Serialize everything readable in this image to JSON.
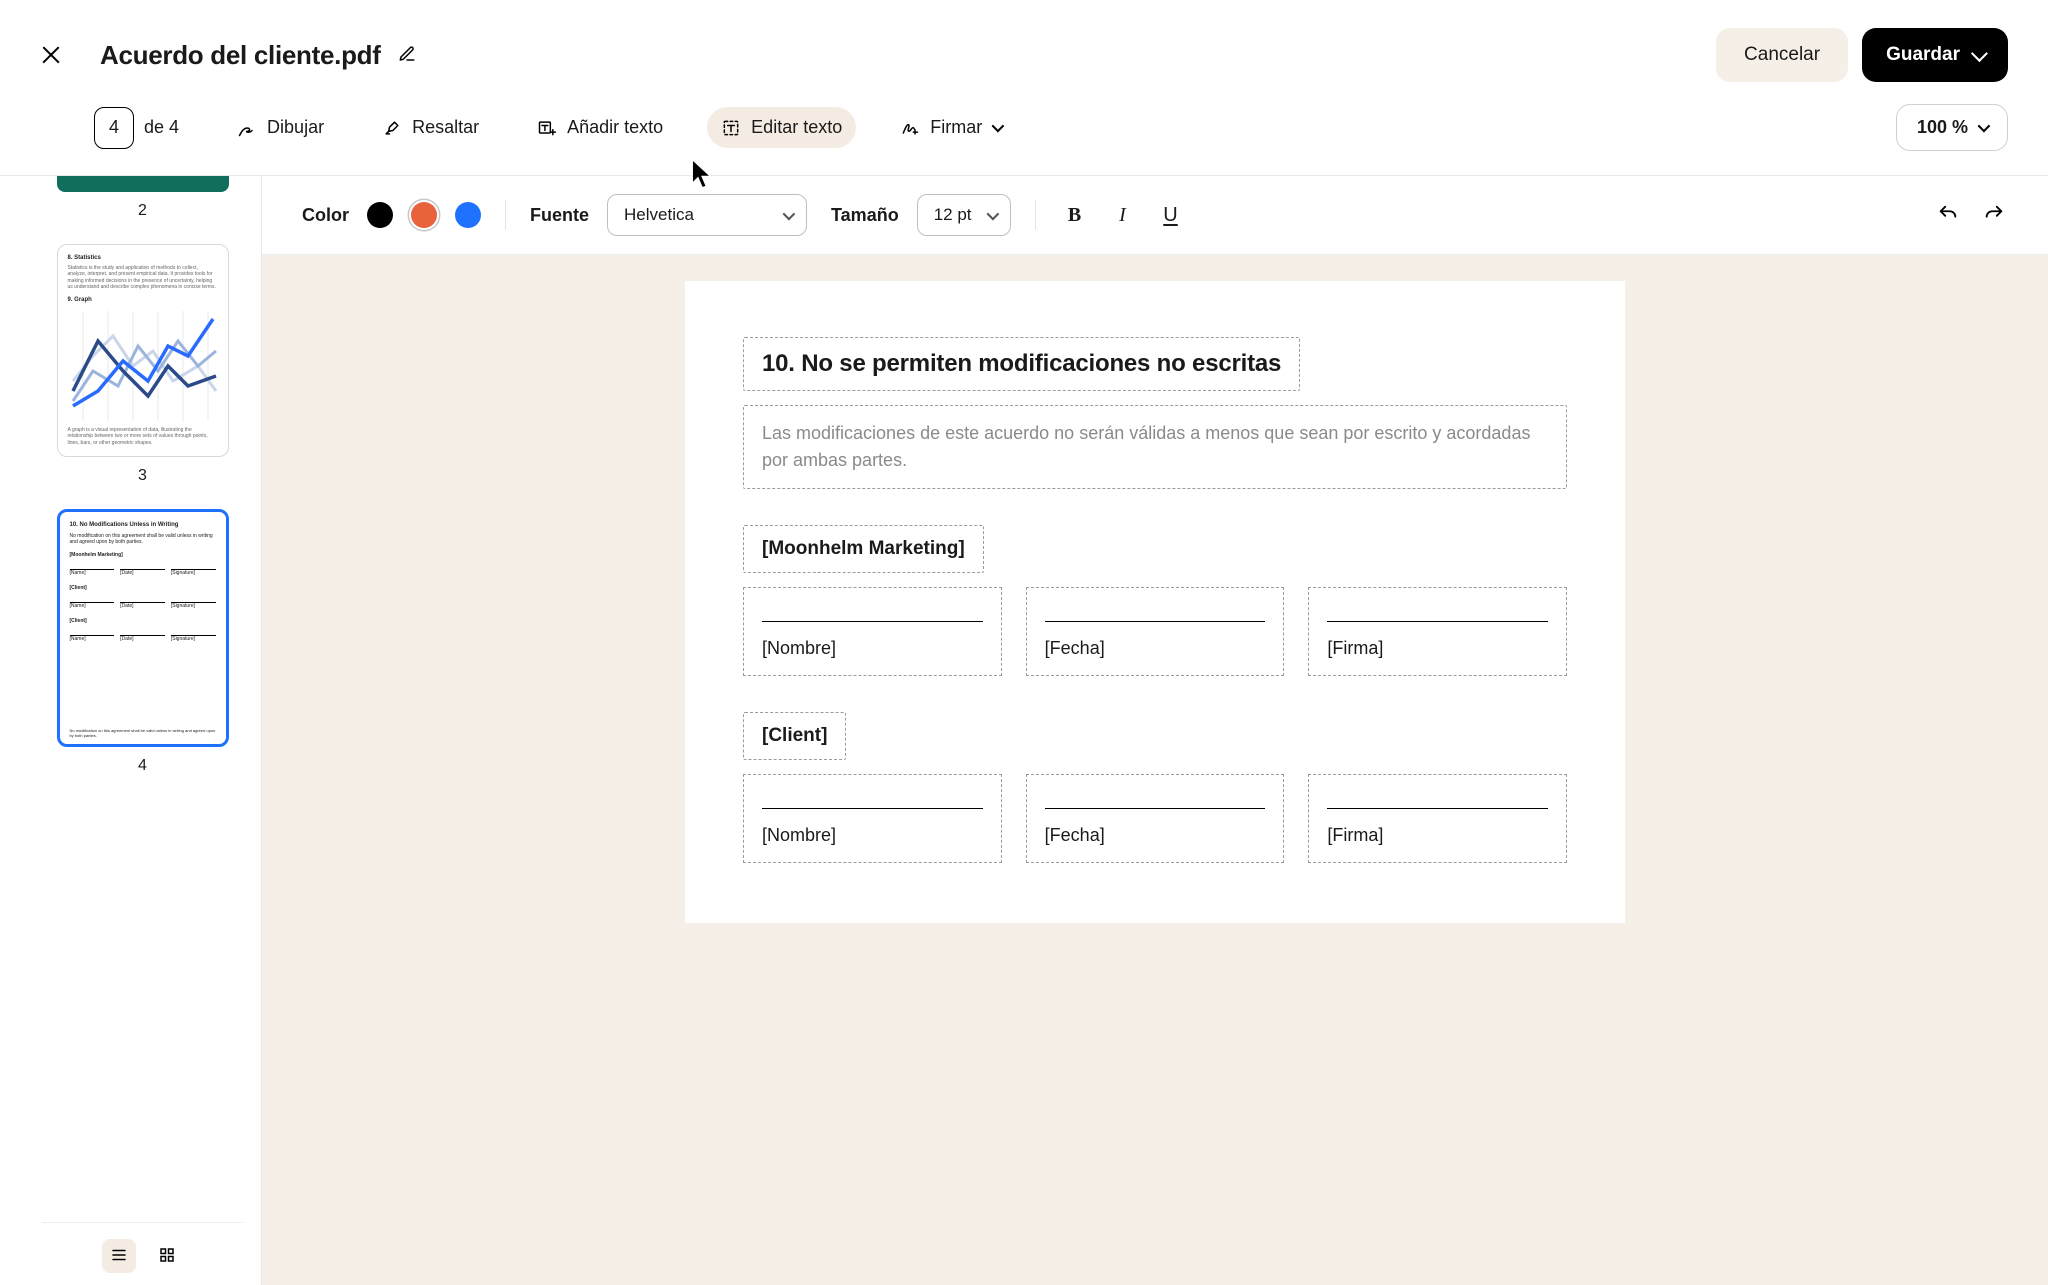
{
  "header": {
    "document_title": "Acuerdo del cliente.pdf",
    "cancel_label": "Cancelar",
    "save_label": "Guardar"
  },
  "toolbar": {
    "page_current": "4",
    "page_of": "de 4",
    "draw": "Dibujar",
    "highlight": "Resaltar",
    "add_text": "Añadir texto",
    "edit_text": "Editar texto",
    "sign": "Firmar",
    "zoom": "100 %"
  },
  "edit_bar": {
    "color_label": "Color",
    "colors": {
      "black": "#000000",
      "orange": "#e8623c",
      "blue": "#1f72ff"
    },
    "selected_color": "orange",
    "font_label": "Fuente",
    "font_value": "Helvetica",
    "size_label": "Tamaño",
    "size_value": "12 pt"
  },
  "sidebar": {
    "thumbs": {
      "p2_num": "2",
      "p3_num": "3",
      "p3_h1": "8. Statistics",
      "p3_body": "Statistics is the study and application of methods to collect, analyze, interpret, and present empirical data. It provides tools for making informed decisions in the presence of uncertainty, helping us understand and describe complex phenomena in concise terms.",
      "p3_h2": "9. Graph",
      "p3_caption": "A graph is a visual representation of data, illustrating the relationship between two or more sets of values through points, lines, bars, or other geometric shapes.",
      "p4_num": "4",
      "p4_h": "10. No Modifications Unless in Writing",
      "p4_body": "No modification on this agreement shall be valid unless in writing and agreed upon by both parties.",
      "p4_company": "[Moonhelm Marketing]",
      "p4_client": "[Client]",
      "p4_name": "[Name]",
      "p4_date": "[Date]",
      "p4_sig": "[Signature]"
    }
  },
  "doc": {
    "heading": "10. No se permiten modificaciones no escritas",
    "paragraph": "Las modificaciones de este acuerdo no serán válidas a menos que sean por escrito y acordadas por ambas partes.",
    "company": "[Moonhelm Marketing]",
    "client": "[Client]",
    "name": "[Nombre]",
    "date": "[Fecha]",
    "signature": "[Firma]"
  }
}
